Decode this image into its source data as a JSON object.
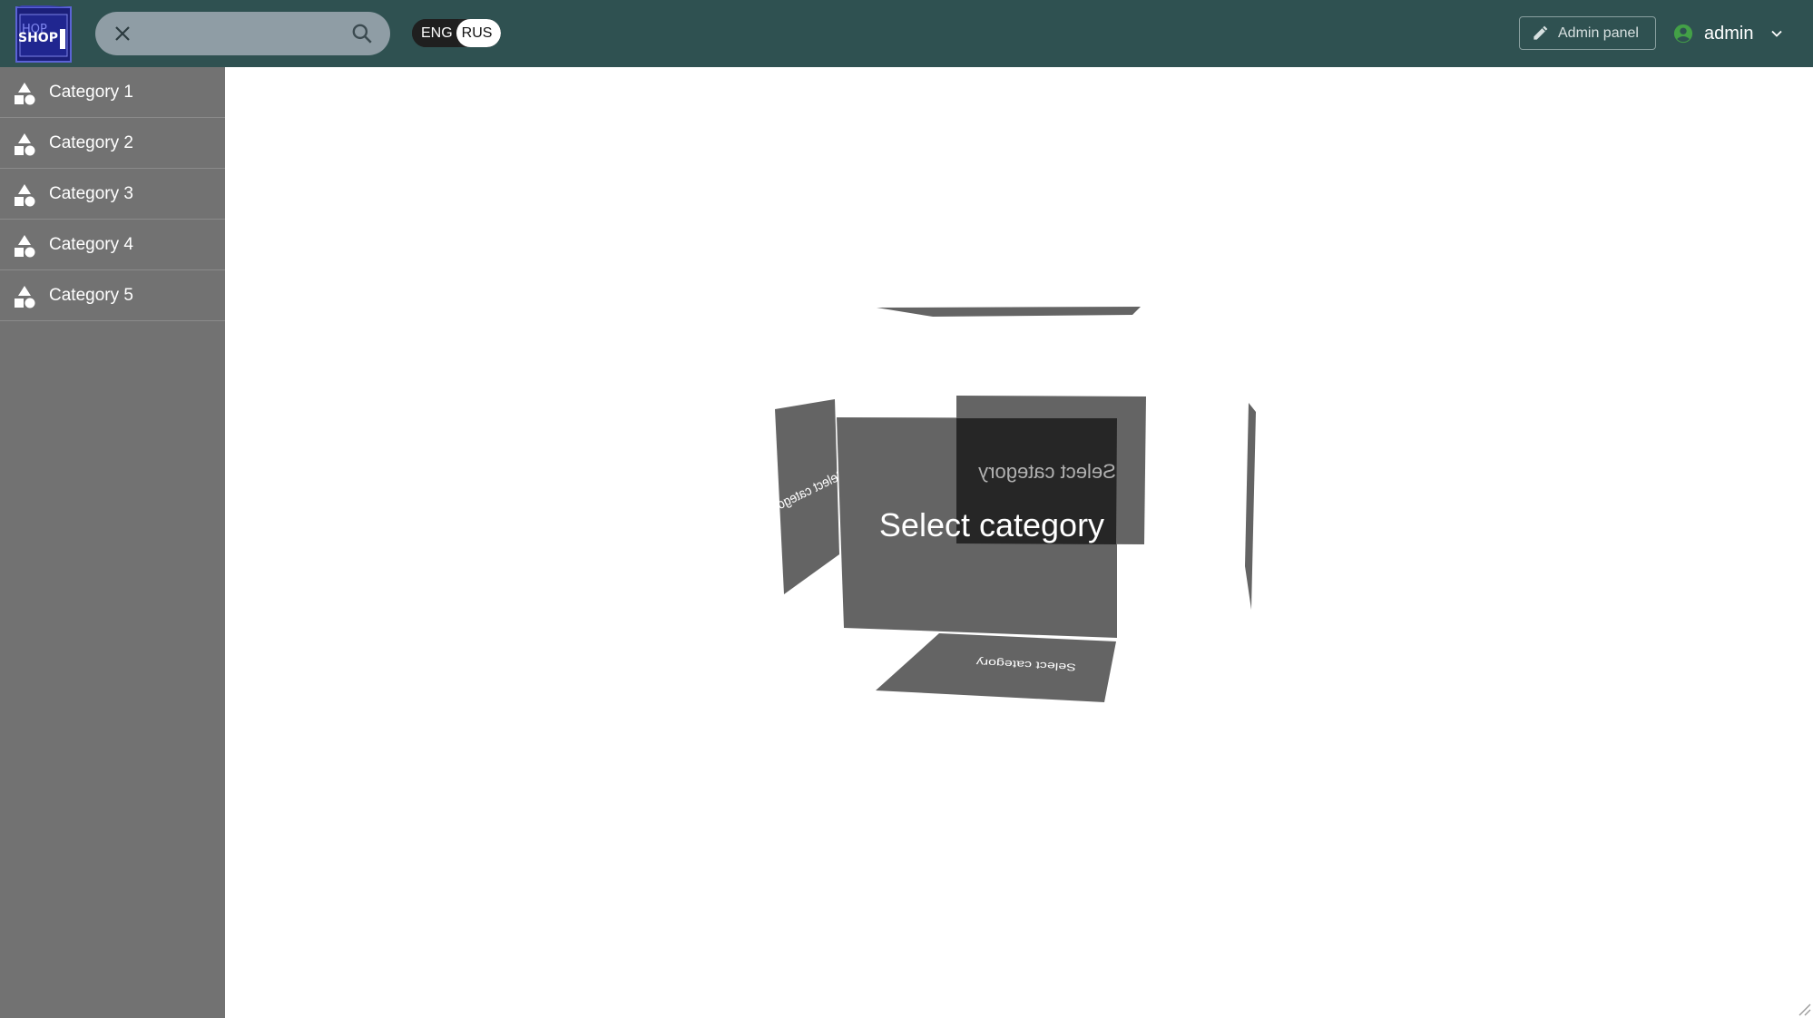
{
  "header": {
    "logo_text": "SHOP",
    "search": {
      "value": "",
      "placeholder": ""
    },
    "lang": {
      "eng": "ENG",
      "rus": "RUS"
    },
    "admin_panel_label": "Admin panel",
    "user_label": "admin"
  },
  "sidebar": {
    "items": [
      {
        "label": "Category 1"
      },
      {
        "label": "Category 2"
      },
      {
        "label": "Category 3"
      },
      {
        "label": "Category 4"
      },
      {
        "label": "Category 5"
      }
    ]
  },
  "main": {
    "cube_face_text": "Select category"
  },
  "colors": {
    "header": "#2f5151",
    "sidebar": "#727272",
    "face": "#646464",
    "face_back": "#262626",
    "user_icon": "#43a047"
  }
}
